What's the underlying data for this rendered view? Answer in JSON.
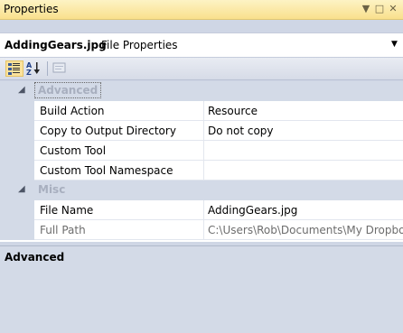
{
  "window": {
    "title": "Properties",
    "pin_glyph": "▼",
    "close_glyph": "✕",
    "maximize_glyph": "□"
  },
  "selector": {
    "object_name": "AddingGears.jpg",
    "object_type": "File Properties",
    "dropdown_glyph": "▼"
  },
  "toolbar": {
    "buttons": [
      {
        "name": "categorized-button",
        "icon": "categorized-icon",
        "active": true
      },
      {
        "name": "alphabetical-button",
        "icon": "sort-az-icon",
        "active": false
      },
      {
        "name": "property-pages-button",
        "icon": "property-pages-icon",
        "active": false
      }
    ]
  },
  "grid": {
    "categories": [
      {
        "name": "Advanced",
        "expander_glyph": "◢",
        "properties": [
          {
            "name": "Build Action",
            "value": "Resource"
          },
          {
            "name": "Copy to Output Directory",
            "value": "Do not copy"
          },
          {
            "name": "Custom Tool",
            "value": ""
          },
          {
            "name": "Custom Tool Namespace",
            "value": ""
          }
        ]
      },
      {
        "name": "Misc",
        "expander_glyph": "◢",
        "properties": [
          {
            "name": "File Name",
            "value": "AddingGears.jpg"
          },
          {
            "name": "Full Path",
            "value": "C:\\Users\\Rob\\Documents\\My Dropbox"
          }
        ]
      }
    ]
  },
  "description": {
    "title": "Advanced"
  },
  "colors": {
    "titlebar_accent": "#f9e08d",
    "panel_background": "#cfd6e5",
    "category_text": "#a8afbf"
  }
}
